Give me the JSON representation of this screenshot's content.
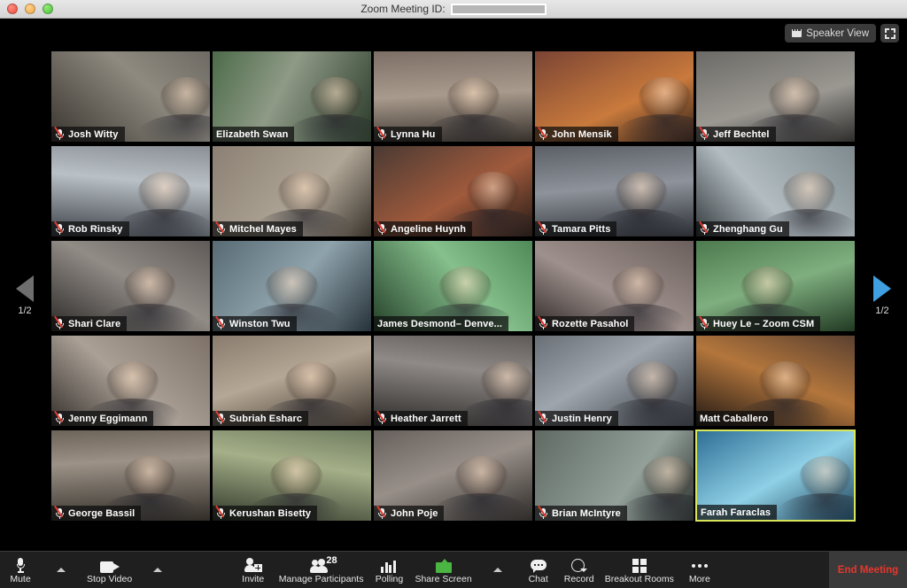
{
  "window": {
    "title_label": "Zoom Meeting ID:",
    "meeting_id_value": "",
    "traffic_lights": [
      "close-red",
      "minimize-yellow",
      "zoom-green"
    ]
  },
  "view_controls": {
    "speaker_view_label": "Speaker View",
    "filmstrip_icon": "filmstrip-icon",
    "fullscreen_icon": "fullscreen-icon"
  },
  "pager": {
    "left_label": "1/2",
    "right_label": "1/2",
    "left_arrow_state": "disabled",
    "right_arrow_state": "enabled",
    "left_arrow_color": "#6e6e6e",
    "right_arrow_color": "#3f9fe0"
  },
  "grid": {
    "columns": 5,
    "rows": 5,
    "active_speaker": "Farah Faraclas",
    "active_border_color": "#d9e65a",
    "participants": [
      {
        "name": "Josh Witty",
        "muted": true,
        "active": false
      },
      {
        "name": "Elizabeth Swan",
        "muted": false,
        "active": false
      },
      {
        "name": "Lynna Hu",
        "muted": true,
        "active": false
      },
      {
        "name": "John Mensik",
        "muted": true,
        "active": false
      },
      {
        "name": "Jeff Bechtel",
        "muted": true,
        "active": false
      },
      {
        "name": "Rob Rinsky",
        "muted": true,
        "active": false
      },
      {
        "name": "Mitchel Mayes",
        "muted": true,
        "active": false
      },
      {
        "name": "Angeline Huynh",
        "muted": true,
        "active": false
      },
      {
        "name": "Tamara Pitts",
        "muted": true,
        "active": false
      },
      {
        "name": "Zhenghang Gu",
        "muted": true,
        "active": false
      },
      {
        "name": "Shari Clare",
        "muted": true,
        "active": false
      },
      {
        "name": "Winston Twu",
        "muted": true,
        "active": false
      },
      {
        "name": "James Desmond– Denve...",
        "muted": false,
        "active": false
      },
      {
        "name": "Rozette Pasahol",
        "muted": true,
        "active": false
      },
      {
        "name": "Huey Le – Zoom CSM",
        "muted": true,
        "active": false
      },
      {
        "name": "Jenny Eggimann",
        "muted": true,
        "active": false
      },
      {
        "name": "Subriah Esharc",
        "muted": true,
        "active": false
      },
      {
        "name": "Heather Jarrett",
        "muted": true,
        "active": false
      },
      {
        "name": "Justin Henry",
        "muted": true,
        "active": false
      },
      {
        "name": "Matt Caballero",
        "muted": false,
        "active": false
      },
      {
        "name": "George Bassil",
        "muted": true,
        "active": false
      },
      {
        "name": "Kerushan Bisetty",
        "muted": true,
        "active": false
      },
      {
        "name": "John Poje",
        "muted": true,
        "active": false
      },
      {
        "name": "Brian McIntyre",
        "muted": true,
        "active": false
      },
      {
        "name": "Farah Faraclas",
        "muted": false,
        "active": true
      }
    ]
  },
  "toolbar": {
    "mute_label": "Mute",
    "mute_caret": "audio-options-caret",
    "stop_video_label": "Stop Video",
    "video_caret": "video-options-caret",
    "invite_label": "Invite",
    "manage_participants_label": "Manage Participants",
    "participants_count": "28",
    "polling_label": "Polling",
    "share_screen_label": "Share Screen",
    "share_caret": "share-options-caret",
    "share_accent_color": "#4bb543",
    "chat_label": "Chat",
    "record_label": "Record",
    "breakout_rooms_label": "Breakout Rooms",
    "more_label": "More",
    "end_meeting_label": "End Meeting",
    "end_meeting_color": "#e8372c"
  }
}
